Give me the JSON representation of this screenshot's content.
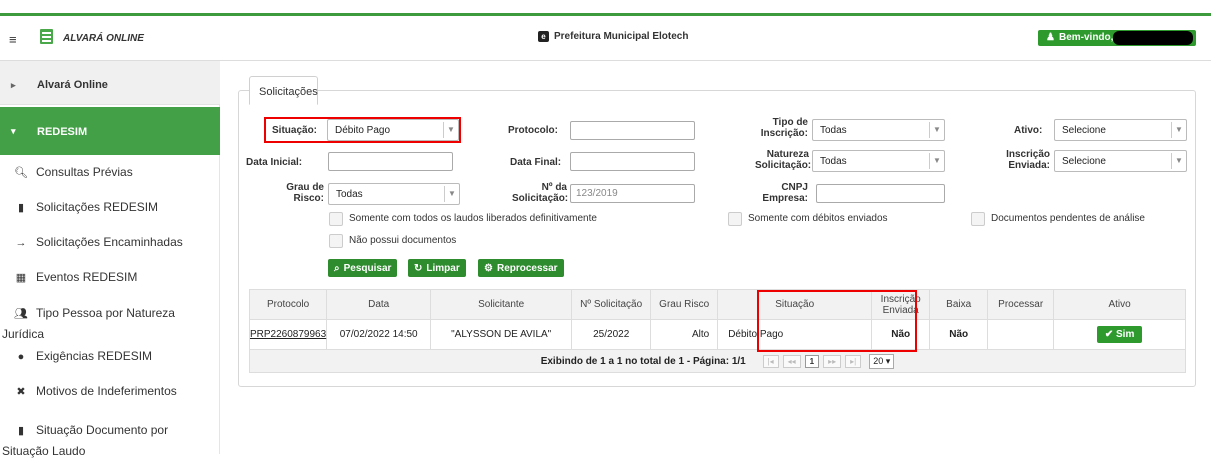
{
  "header": {
    "app_title": "ALVARÁ ONLINE",
    "brand": "Prefeitura Municipal Elotech",
    "welcome": "Bem-vindo,"
  },
  "sidebar": {
    "items": [
      {
        "label": "Alvará Online",
        "icon": "chevron-right-icon"
      },
      {
        "label": "REDESIM",
        "icon": "chevron-down-icon"
      },
      {
        "label": "Consultas Prévias",
        "icon": "search-icon"
      },
      {
        "label": "Solicitações REDESIM",
        "icon": "file-icon"
      },
      {
        "label": "Solicitações Encaminhadas",
        "icon": "arrow-right-icon"
      },
      {
        "label": "Eventos REDESIM",
        "icon": "calendar-icon"
      },
      {
        "label1": "Tipo Pessoa por Natureza",
        "label2": "Jurídica",
        "icon": "users-icon"
      },
      {
        "label": "Exigências REDESIM",
        "icon": "info-icon"
      },
      {
        "label": "Motivos de Indeferimentos",
        "icon": "close-circle-icon"
      },
      {
        "label1": "Situação Documento por",
        "label2": "Situação Laudo",
        "icon": "file-icon"
      }
    ]
  },
  "tab": {
    "label": "Solicitações"
  },
  "filters": {
    "situacao_label": "Situação:",
    "situacao_value": "Débito Pago",
    "protocolo_label": "Protocolo:",
    "tipo_inscricao_label1": "Tipo de",
    "tipo_inscricao_label2": "Inscrição:",
    "tipo_inscricao_value": "Todas",
    "ativo_label": "Ativo:",
    "ativo_value": "Selecione",
    "data_inicial_label": "Data Inicial:",
    "data_final_label": "Data Final:",
    "natureza_label1": "Natureza",
    "natureza_label2": "Solicitação:",
    "natureza_value": "Todas",
    "inscricao_enviada_label1": "Inscrição",
    "inscricao_enviada_label2": "Enviada:",
    "inscricao_enviada_value": "Selecione",
    "grau_label1": "Grau de",
    "grau_label2": "Risco:",
    "grau_value": "Todas",
    "nsol_label1": "Nº da",
    "nsol_label2": "Solicitação:",
    "nsol_placeholder": "123/2019",
    "cnpj_label1": "CNPJ",
    "cnpj_label2": "Empresa:",
    "cb_laudos": "Somente com todos os laudos liberados definitivamente",
    "cb_debitos": "Somente com débitos enviados",
    "cb_docs_pendentes": "Documentos pendentes de análise",
    "cb_sem_docs": "Não possui documentos"
  },
  "buttons": {
    "pesquisar": "Pesquisar",
    "limpar": "Limpar",
    "reprocessar": "Reprocessar"
  },
  "table": {
    "columns": [
      "Protocolo",
      "Data",
      "Solicitante",
      "Nº Solicitação",
      "Grau Risco",
      "Situação",
      "Inscrição Enviada",
      "Baixa",
      "Processar",
      "Ativo"
    ],
    "rows": [
      {
        "protocolo": "PRP2260879963",
        "data": "07/02/2022 14:50",
        "solicitante": "\"ALYSSON DE AVILA\"",
        "nsol": "25/2022",
        "grau": "Alto",
        "situacao": "Débito Pago",
        "inscricao": "Não",
        "baixa": "Não",
        "processar": "",
        "ativo": "Sim"
      }
    ],
    "footer": "Exibindo de 1 a 1 no total de 1 - Página: 1/1",
    "current_page": "1",
    "per_page": "20"
  }
}
